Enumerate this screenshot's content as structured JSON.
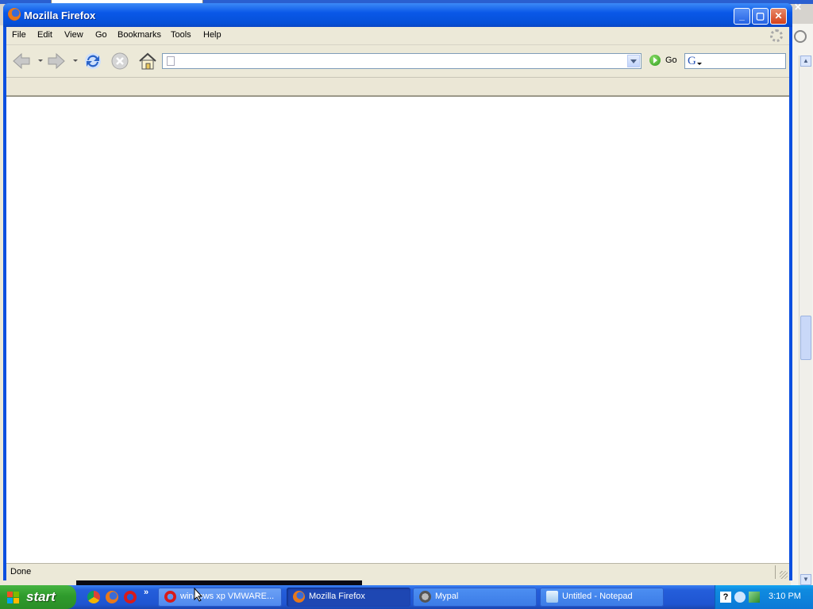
{
  "window": {
    "title": "Mozilla Firefox"
  },
  "menu": {
    "file": "File",
    "edit": "Edit",
    "view": "View",
    "go": "Go",
    "bookmarks": "Bookmarks",
    "tools": "Tools",
    "help": "Help"
  },
  "nav": {
    "url_value": "",
    "go_label": "Go",
    "search_value": ""
  },
  "status": {
    "text": "Done"
  },
  "taskbar": {
    "start_label": "start",
    "more": "»",
    "tasks": [
      {
        "label": "windows xp VMWARE...",
        "icon": "opera-icon"
      },
      {
        "label": "Mozilla Firefox",
        "icon": "firefox-icon"
      },
      {
        "label": "Mypal",
        "icon": "mypal-icon"
      },
      {
        "label": "Untitled - Notepad",
        "icon": "notepad-icon"
      }
    ],
    "clock": "3:10 PM"
  },
  "icons": [
    "firefox-icon",
    "minimize-icon",
    "maximize-icon",
    "close-icon",
    "back-arrow-icon",
    "forward-arrow-icon",
    "reload-icon",
    "stop-icon",
    "home-icon",
    "page-icon",
    "go-icon",
    "google-search-icon",
    "throbber-icon",
    "windows-flag-icon",
    "chrome-icon",
    "opera-icon",
    "help-icon",
    "network-icon"
  ],
  "colors": {
    "titlebar": "#0a58e8",
    "taskbar": "#245edb",
    "start": "#2f9b2c",
    "tray": "#0f8be0"
  }
}
